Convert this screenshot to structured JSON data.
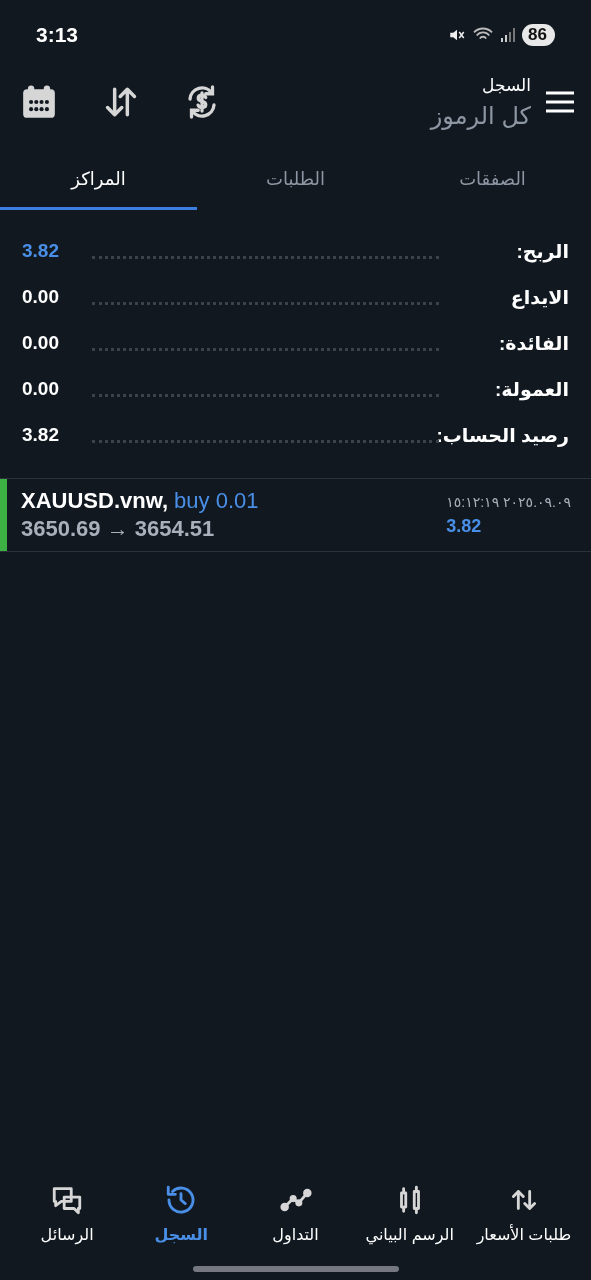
{
  "status_bar": {
    "time": "3:13",
    "battery": "86"
  },
  "header": {
    "title": "السجل",
    "subtitle": "كل الرموز"
  },
  "tabs": [
    {
      "label": "الصفقات",
      "selected": false
    },
    {
      "label": "الطلبات",
      "selected": false
    },
    {
      "label": "المراكز",
      "selected": true
    }
  ],
  "summary": [
    {
      "label": "الربح:",
      "value": "3.82",
      "color": "#4a8fe7"
    },
    {
      "label": "الايداع",
      "value": "0.00",
      "color": "#ffffff"
    },
    {
      "label": "الفائدة:",
      "value": "0.00",
      "color": "#ffffff"
    },
    {
      "label": "العمولة:",
      "value": "0.00",
      "color": "#ffffff"
    },
    {
      "label": "رصيد الحساب:",
      "value": "3.82",
      "color": "#ffffff"
    }
  ],
  "positions": [
    {
      "symbol": "XAUUSD.vnw,",
      "side": "buy 0.01",
      "prices": "3650.69 → 3654.51",
      "time": "٢٠٢٥.٠٩.٠٩ ١٥:١٢:١٩",
      "profit": "3.82",
      "color": "#3cb043"
    }
  ],
  "bottom_nav": [
    {
      "label": "طلبات الأسعار",
      "selected": false
    },
    {
      "label": "الرسم البياني",
      "selected": false
    },
    {
      "label": "التداول",
      "selected": false
    },
    {
      "label": "السجل",
      "selected": true
    },
    {
      "label": "الرسائل",
      "selected": false
    }
  ]
}
